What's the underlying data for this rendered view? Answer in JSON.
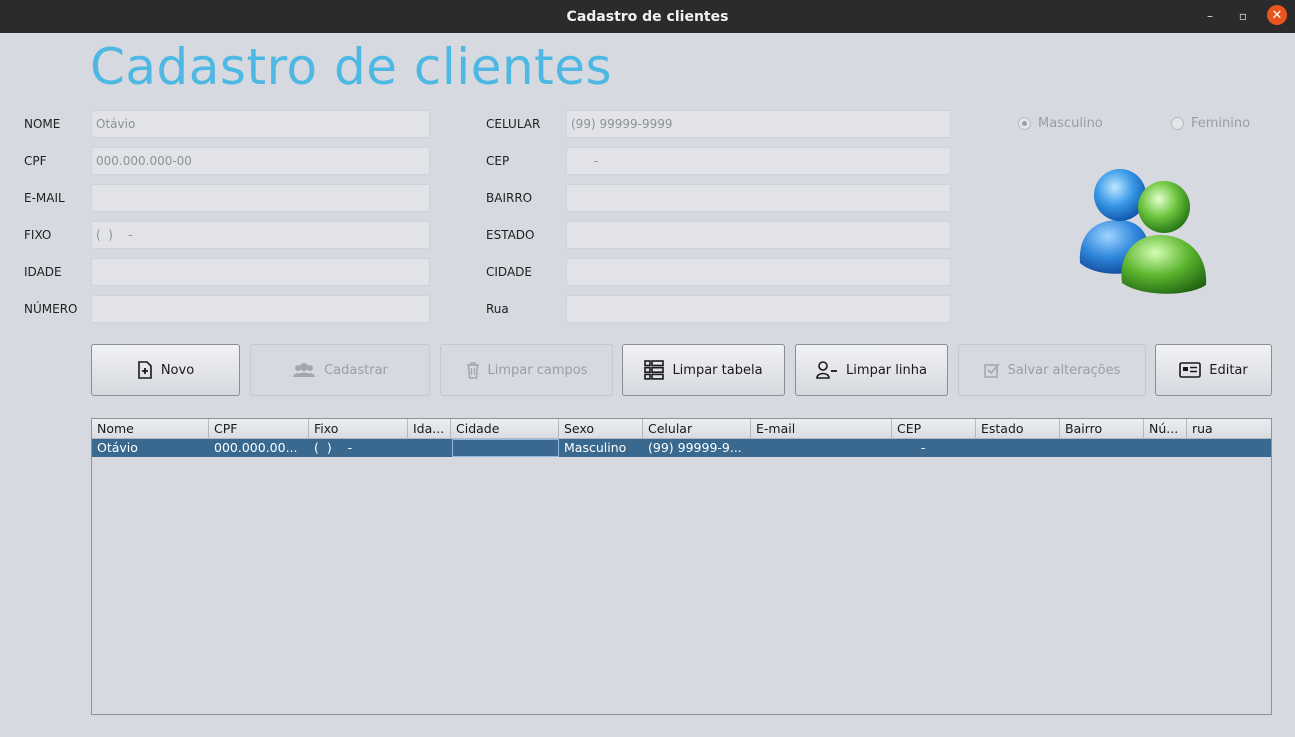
{
  "window": {
    "title": "Cadastro de clientes",
    "minimize_icon": "–",
    "maximize_icon": "▫",
    "close_icon": "✕"
  },
  "header": {
    "title": "Cadastro de clientes"
  },
  "form": {
    "nome": {
      "label": "NOME",
      "value": "Otávio"
    },
    "cpf": {
      "label": "CPF",
      "value": "000.000.000-00"
    },
    "email": {
      "label": "E-MAIL",
      "value": ""
    },
    "fixo": {
      "label": "FIXO",
      "value": "(  )    -"
    },
    "idade": {
      "label": "IDADE",
      "value": ""
    },
    "numero": {
      "label": "NÚMERO",
      "value": ""
    },
    "celular": {
      "label": "CELULAR",
      "value": "(99) 99999-9999"
    },
    "cep": {
      "label": "CEP",
      "value": "      -"
    },
    "bairro": {
      "label": "BAIRRO",
      "value": ""
    },
    "estado": {
      "label": "ESTADO",
      "value": ""
    },
    "cidade": {
      "label": "CIDADE",
      "value": ""
    },
    "rua": {
      "label": "Rua",
      "value": ""
    }
  },
  "sexo": {
    "masculino": {
      "label": "Masculino",
      "selected": true
    },
    "feminino": {
      "label": "Feminino",
      "selected": false
    }
  },
  "buttons": {
    "novo": "Novo",
    "cadastrar": "Cadastrar",
    "limpar_campos": "Limpar campos",
    "limpar_tabela": "Limpar tabela",
    "limpar_linha": "Limpar linha",
    "salvar_alteracoes": "Salvar alterações",
    "editar": "Editar"
  },
  "table": {
    "columns": [
      "Nome",
      "CPF",
      "Fixo",
      "Ida...",
      "Cidade",
      "Sexo",
      "Celular",
      "E-mail",
      "CEP",
      "Estado",
      "Bairro",
      "Nú...",
      "rua"
    ],
    "rows": [
      [
        "Otávio",
        "000.000.00...",
        "(  )    -",
        "",
        "",
        "Masculino",
        "(99) 99999-9...",
        "",
        "      -",
        "",
        "",
        "",
        ""
      ]
    ]
  },
  "colors": {
    "title_accent": "#4db8e3",
    "selected_row": "#39698f",
    "close_button": "#e9541f"
  }
}
